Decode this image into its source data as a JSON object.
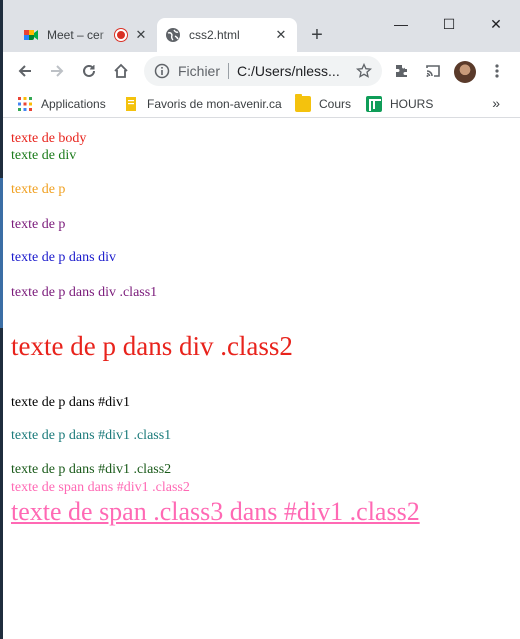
{
  "browser": {
    "tabs": [
      {
        "title": "Meet – cer",
        "active": false,
        "recording": true
      },
      {
        "title": "css2.html",
        "active": true
      }
    ],
    "address": {
      "scheme": "Fichier",
      "url": "C:/Users/nless..."
    },
    "bookmarks": [
      {
        "label": "Applications",
        "icon": "apps-grid-icon"
      },
      {
        "label": "Favoris de mon-avenir.ca",
        "icon": "bookmark-page-icon"
      },
      {
        "label": "Cours",
        "icon": "folder-icon"
      },
      {
        "label": "HOURS",
        "icon": "sheets-icon"
      }
    ],
    "more_bookmarks": "»"
  },
  "page": {
    "lines": [
      {
        "text": "texte de body",
        "color": "#e8231c"
      },
      {
        "text": "texte de div",
        "color": "#1a7a1a"
      },
      {
        "text": "texte de p",
        "color": "#f0a020"
      },
      {
        "text": "texte de p",
        "color": "#7a1a7a"
      },
      {
        "text": "texte de p dans div",
        "color": "#1a1acc"
      },
      {
        "text": "texte de p dans div .class1",
        "color": "#7a1a7a"
      },
      {
        "text": "texte de p dans div .class2",
        "color": "#e8231c"
      },
      {
        "text": "texte de p dans #div1",
        "color": "#000000"
      },
      {
        "text": "texte de p dans #div1 .class1",
        "color": "#1a7a7a"
      },
      {
        "text": "texte de p dans #div1 .class2",
        "color": "#1a5a1a"
      },
      {
        "text": "texte de span dans #div1 .class2",
        "color": "#ff69b4"
      },
      {
        "text": "texte de span .class3 dans #div1 .class2",
        "color": "#ff69b4"
      }
    ]
  },
  "colors": {
    "tabstrip": "#dee1e6",
    "accent_pink": "#ff69b4"
  }
}
